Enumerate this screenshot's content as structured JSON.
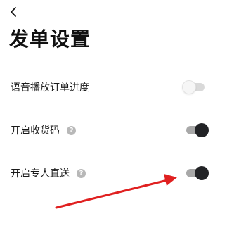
{
  "header": {
    "title": "发单设置",
    "back_icon": "chevron-left-icon"
  },
  "settings": [
    {
      "label": "语音播放订单进度",
      "has_help": false,
      "enabled": false
    },
    {
      "label": "开启收货码",
      "has_help": true,
      "enabled": true
    },
    {
      "label": "开启专人直送",
      "has_help": true,
      "enabled": true
    }
  ],
  "help_icon_glyph": "?",
  "colors": {
    "toggle_on_knob": "#222326",
    "toggle_on_track": "#a8a8a8",
    "toggle_off_track": "#d9d9d9",
    "annotation_arrow": "#e02020"
  }
}
